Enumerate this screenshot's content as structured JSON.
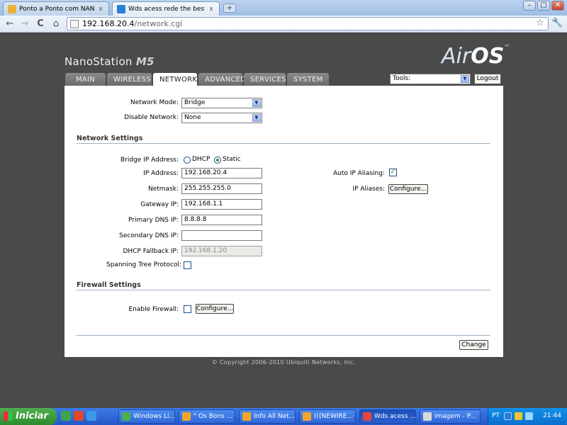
{
  "browser": {
    "tabs": [
      {
        "label": "Ponto a Ponto com NANO ...",
        "close": "x"
      },
      {
        "label": "Wds acess rede the best: [...",
        "close": "x"
      }
    ],
    "new_tab": "+",
    "window_buttons": {
      "minimize": "–",
      "maximize": "□",
      "close": "✕"
    },
    "nav": {
      "back": "←",
      "forward": "→",
      "reload": "C",
      "home": "⌂"
    },
    "url_host": "192.168.20.4",
    "url_path": "/network.cgi",
    "star": "☆",
    "wrench": "🔧"
  },
  "header": {
    "brand": "NanoStation",
    "model": "M5",
    "logo_air": "Air",
    "logo_os": "OS",
    "logo_tm": "™"
  },
  "nav_tabs": [
    "MAIN",
    "WIRELESS",
    "NETWORK",
    "ADVANCED",
    "SERVICES",
    "SYSTEM"
  ],
  "active_tab": "NETWORK",
  "tools": {
    "value": "Tools:",
    "arrow": "▼"
  },
  "logout": "Logout",
  "form": {
    "network_mode": {
      "label": "Network Mode:",
      "value": "Bridge"
    },
    "disable_network": {
      "label": "Disable Network:",
      "value": "None"
    },
    "network_settings_title": "Network Settings",
    "bridge_ip": {
      "label": "Bridge IP Address:",
      "dhcp": "DHCP",
      "static": "Static",
      "selected": "Static"
    },
    "ip_address": {
      "label": "IP Address:",
      "value": "192.168.20.4"
    },
    "netmask": {
      "label": "Netmask:",
      "value": "255.255.255.0"
    },
    "gateway": {
      "label": "Gateway IP:",
      "value": "192.168.1.1"
    },
    "primary_dns": {
      "label": "Primary DNS IP:",
      "value": "8.8.8.8"
    },
    "secondary_dns": {
      "label": "Secondary DNS IP:",
      "value": ""
    },
    "dhcp_fallback": {
      "label": "DHCP Fallback IP:",
      "value": "192.168.1.20"
    },
    "spanning_tree": {
      "label": "Spanning Tree Protocol:",
      "checked": false
    },
    "auto_ip_aliasing": {
      "label": "Auto IP Aliasing:",
      "checked": true,
      "mark": "✓"
    },
    "ip_aliases": {
      "label": "IP Aliases:",
      "button": "Configure..."
    },
    "firewall_settings_title": "Firewall Settings",
    "enable_firewall": {
      "label": "Enable Firewall:",
      "checked": false,
      "button": "Configure..."
    },
    "change_button": "Change"
  },
  "footer": "© Copyright 2006-2010 Ubiquiti Networks, Inc.",
  "taskbar": {
    "start": "Iniciar",
    "tasks": [
      "Windows Li...",
      "\" Os Bons ...",
      "Info All Net...",
      "(((NEWIRE...",
      "Wds acess ...",
      "imagem - P..."
    ],
    "lang": "PT",
    "clock": "21:44"
  },
  "colors": {
    "accent": "#2f8f2f",
    "page_bg": "#4a4a4a",
    "taskbar": "#2457c9"
  }
}
